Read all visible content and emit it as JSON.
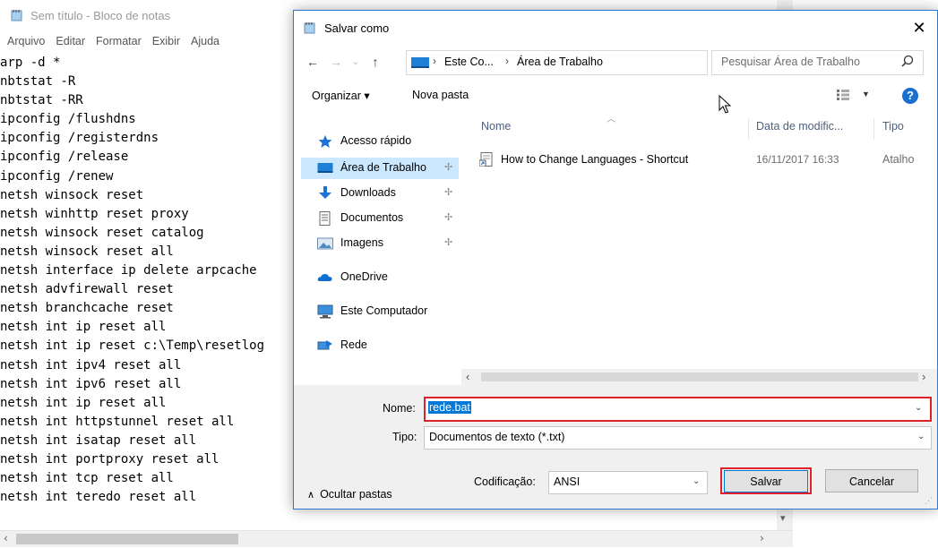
{
  "notepad": {
    "title": "Sem título - Bloco de notas",
    "menu": [
      "Arquivo",
      "Editar",
      "Formatar",
      "Exibir",
      "Ajuda"
    ],
    "lines": [
      "arp -d *",
      "nbtstat -R",
      "nbtstat -RR",
      "ipconfig /flushdns",
      "ipconfig /registerdns",
      "ipconfig /release",
      "ipconfig /renew",
      "netsh winsock reset",
      "netsh winhttp reset proxy",
      "netsh winsock reset catalog",
      "netsh winsock reset all",
      "netsh interface ip delete arpcache",
      "netsh advfirewall reset",
      "netsh branchcache reset",
      "netsh int ip reset all",
      "netsh int ip reset c:\\Temp\\resetlog",
      "netsh int ipv4 reset all",
      "netsh int ipv6 reset all",
      "netsh int ip reset all",
      "netsh int httpstunnel reset all",
      "netsh int isatap reset all",
      "netsh int portproxy reset all",
      "netsh int tcp reset all",
      "netsh int teredo reset all"
    ]
  },
  "dialog": {
    "title": "Salvar como",
    "close_label": "✕",
    "breadcrumb": [
      "Este Co...",
      "Área de Trabalho"
    ],
    "search_placeholder": "Pesquisar Área de Trabalho",
    "toolbar": {
      "organize": "Organizar ▾",
      "new_folder": "Nova pasta"
    },
    "nav": {
      "quick_access": "Acesso rápido",
      "items": [
        {
          "label": "Área de Trabalho",
          "icon": "desktop-icon",
          "pinned": true,
          "selected": true
        },
        {
          "label": "Downloads",
          "icon": "download-icon",
          "pinned": true
        },
        {
          "label": "Documentos",
          "icon": "documents-icon",
          "pinned": true
        },
        {
          "label": "Imagens",
          "icon": "pictures-icon",
          "pinned": true
        }
      ],
      "onedrive": "OneDrive",
      "this_pc": "Este Computador",
      "network": "Rede"
    },
    "columns": {
      "name": "Nome",
      "date": "Data de modific...",
      "type": "Tipo"
    },
    "files": [
      {
        "name": "How to Change Languages - Shortcut",
        "date": "16/11/2017 16:33",
        "type": "Atalho"
      }
    ],
    "form": {
      "name_label": "Nome:",
      "name_value": "rede.bat",
      "type_label": "Tipo:",
      "type_value": "Documentos de texto (*.txt)",
      "encoding_label": "Codificação:",
      "encoding_value": "ANSI",
      "hide_folders": "Ocultar pastas",
      "save": "Salvar",
      "cancel": "Cancelar"
    },
    "colors": {
      "highlight": "#e0202a",
      "selection": "#0078d7",
      "nav_selected": "#cce8ff"
    }
  }
}
